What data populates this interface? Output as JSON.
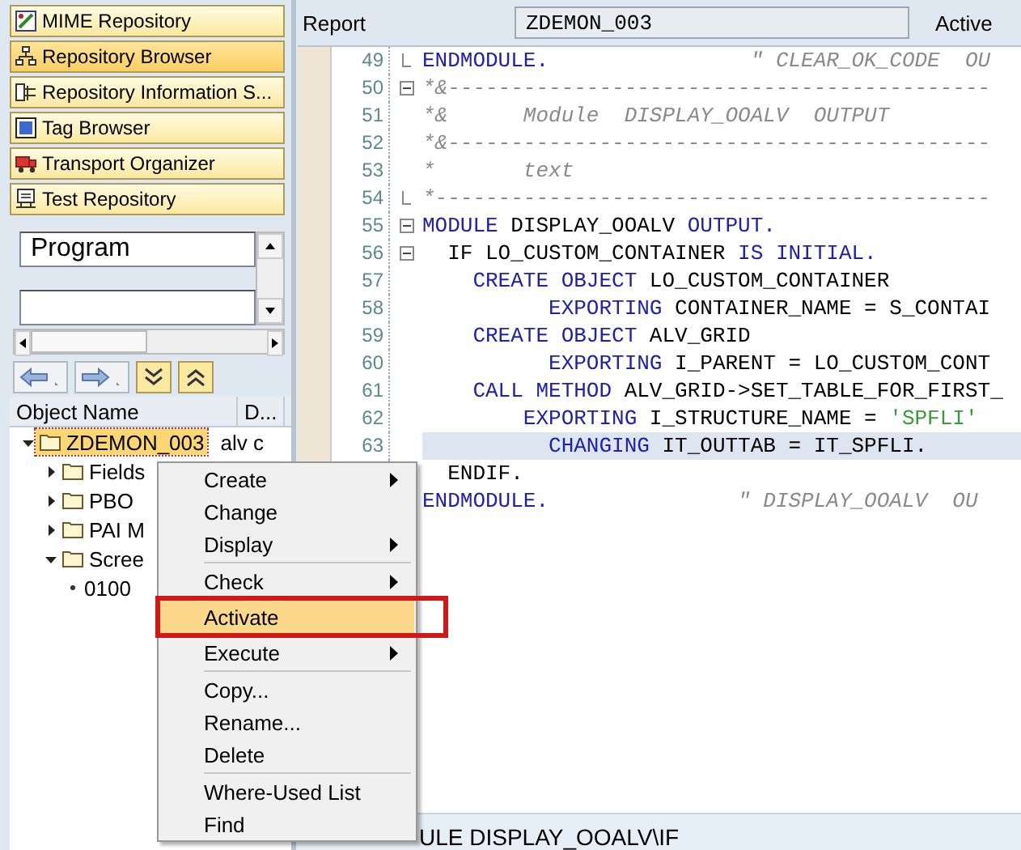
{
  "navigation": [
    {
      "label": "MIME Repository",
      "selected": false
    },
    {
      "label": "Repository Browser",
      "selected": true
    },
    {
      "label": "Repository Information S...",
      "selected": false
    },
    {
      "label": "Tag Browser",
      "selected": false
    },
    {
      "label": "Transport Organizer",
      "selected": false
    },
    {
      "label": "Test Repository",
      "selected": false
    }
  ],
  "object_type": {
    "value": "Program"
  },
  "tree": {
    "columns": [
      "Object Name",
      "D..."
    ],
    "nodes": [
      {
        "name": "ZDEMON_003",
        "description": "alv c",
        "expanded": true,
        "selected": true,
        "children": [
          {
            "name": "Fields",
            "expanded": false,
            "selected": false
          },
          {
            "name": "PBO",
            "expanded": false,
            "selected": false
          },
          {
            "name": "PAI M",
            "expanded": false,
            "selected": false
          },
          {
            "name": "Scree",
            "expanded": true,
            "selected": false,
            "children": [
              {
                "name": "0100",
                "selected": false
              }
            ]
          }
        ]
      }
    ]
  },
  "header": {
    "label": "Report",
    "value": "ZDEMON_003",
    "status": "Active"
  },
  "code": [
    {
      "number": "49",
      "kind": "fold_end",
      "highlighted": false,
      "segments": [
        {
          "kind": "keyword",
          "text": "ENDMODULE."
        },
        {
          "kind": "comment",
          "text": "                \" CLEAR_OK_CODE  OU"
        }
      ]
    },
    {
      "number": "50",
      "kind": "fold_start",
      "highlighted": false,
      "segments": [
        {
          "kind": "comment",
          "text": "*&-------------------------------------------"
        }
      ]
    },
    {
      "number": "51",
      "highlighted": false,
      "segments": [
        {
          "kind": "comment",
          "text": "*&      Module  DISPLAY_OOALV  OUTPUT"
        }
      ]
    },
    {
      "number": "52",
      "highlighted": false,
      "segments": [
        {
          "kind": "comment",
          "text": "*&-------------------------------------------"
        }
      ]
    },
    {
      "number": "53",
      "highlighted": false,
      "segments": [
        {
          "kind": "comment",
          "text": "*       text"
        }
      ]
    },
    {
      "number": "54",
      "kind": "fold_end",
      "highlighted": false,
      "segments": [
        {
          "kind": "comment",
          "text": "*--------------------------------------------"
        }
      ]
    },
    {
      "number": "55",
      "kind": "fold_start",
      "highlighted": false,
      "segments": [
        {
          "kind": "keyword",
          "text": "MODULE"
        },
        {
          "kind": "plain",
          "text": " DISPLAY_OOALV "
        },
        {
          "kind": "keyword",
          "text": "OUTPUT."
        }
      ]
    },
    {
      "number": "56",
      "kind": "fold_start",
      "highlighted": false,
      "segments": [
        {
          "kind": "plain",
          "text": "  IF LO_CUSTOM_CONTAINER "
        },
        {
          "kind": "keyword",
          "text": "IS INITIAL."
        }
      ]
    },
    {
      "number": "57",
      "highlighted": false,
      "segments": [
        {
          "kind": "keyword",
          "text": "    CREATE OBJECT"
        },
        {
          "kind": "plain",
          "text": " LO_CUSTOM_CONTAINER"
        }
      ]
    },
    {
      "number": "58",
      "highlighted": false,
      "segments": [
        {
          "kind": "keyword",
          "text": "          EXPORTING"
        },
        {
          "kind": "plain",
          "text": " CONTAINER_NAME = S_CONTAI"
        }
      ]
    },
    {
      "number": "59",
      "highlighted": false,
      "segments": [
        {
          "kind": "keyword",
          "text": "    CREATE OBJECT"
        },
        {
          "kind": "plain",
          "text": " ALV_GRID"
        }
      ]
    },
    {
      "number": "60",
      "highlighted": false,
      "segments": [
        {
          "kind": "keyword",
          "text": "          EXPORTING"
        },
        {
          "kind": "plain",
          "text": " I_PARENT = LO_CUSTOM_CONT"
        }
      ]
    },
    {
      "number": "61",
      "highlighted": false,
      "segments": [
        {
          "kind": "keyword",
          "text": "    CALL METHOD"
        },
        {
          "kind": "plain",
          "text": " ALV_GRID->SET_TABLE_FOR_FIRST_"
        }
      ]
    },
    {
      "number": "62",
      "highlighted": false,
      "segments": [
        {
          "kind": "keyword",
          "text": "        EXPORTING"
        },
        {
          "kind": "plain",
          "text": " I_STRUCTURE_NAME = "
        },
        {
          "kind": "string",
          "text": "'SPFLI'"
        }
      ]
    },
    {
      "number": "63",
      "highlighted": true,
      "segments": [
        {
          "kind": "keyword",
          "text": "          CHANGING"
        },
        {
          "kind": "plain",
          "text": " IT_OUTTAB = IT_SPFLI."
        }
      ]
    },
    {
      "highlighted": false,
      "segments": [
        {
          "kind": "plain",
          "text": "  ENDIF."
        }
      ]
    },
    {
      "highlighted": false,
      "segments": [
        {
          "kind": "keyword",
          "text": "ENDMODULE."
        },
        {
          "kind": "comment",
          "text": "               \" DISPLAY_OOALV  OU"
        }
      ]
    }
  ],
  "status_bar": {
    "text": "ULE DISPLAY_OOALV\\IF"
  },
  "context_menu": [
    {
      "kind": "item",
      "label": "Create",
      "submenu": true,
      "selected": false
    },
    {
      "kind": "item",
      "label": "Change",
      "submenu": false,
      "selected": false
    },
    {
      "kind": "item",
      "label": "Display",
      "submenu": true,
      "selected": false
    },
    {
      "kind": "separator"
    },
    {
      "kind": "item",
      "label": "Check",
      "submenu": true,
      "selected": false
    },
    {
      "kind": "item",
      "label": "Activate",
      "submenu": false,
      "selected": true
    },
    {
      "kind": "item",
      "label": "Execute",
      "submenu": true,
      "selected": false
    },
    {
      "kind": "separator"
    },
    {
      "kind": "item",
      "label": "Copy...",
      "submenu": false,
      "selected": false
    },
    {
      "kind": "item",
      "label": "Rename...",
      "submenu": false,
      "selected": false
    },
    {
      "kind": "item",
      "label": "Delete",
      "submenu": false,
      "selected": false
    },
    {
      "kind": "separator"
    },
    {
      "kind": "item",
      "label": "Where-Used List",
      "submenu": false,
      "selected": false
    },
    {
      "kind": "item",
      "label": "Find",
      "submenu": false,
      "selected": false
    }
  ]
}
